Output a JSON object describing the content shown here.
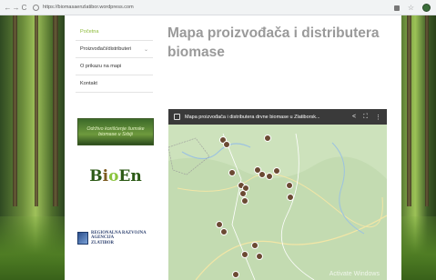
{
  "browser": {
    "back_icon": "arrow-left-icon",
    "forward_icon": "arrow-right-icon",
    "reload_icon": "reload-icon",
    "url": "https://biomasaenzlatibor.wordpress.com"
  },
  "menu": {
    "items": [
      {
        "label": "Početna",
        "active": true
      },
      {
        "label": "Proizvođači/distributeri",
        "dropdown": true
      },
      {
        "label": "O prikazu na mapi"
      },
      {
        "label": "Kontakt"
      }
    ]
  },
  "widgets": {
    "banner_text": "Održivo korišćenje šumske biomase u Srbiji",
    "bioen_logo": "BioEn",
    "agency_lines": [
      "REGIONALNA RAZVOJNA",
      "AGENCIJA",
      "ZLATIBOR"
    ]
  },
  "page": {
    "title": "Mapa proizvođača i distributera biomase"
  },
  "map": {
    "title": "Mapa proizvođača i distributera drvne biomase u Zlatiborsk...",
    "share_icon": "share-icon",
    "fullscreen_icon": "fullscreen-icon",
    "more_icon": "more-vert-icon",
    "marker_color": "#6b4a33",
    "watermark": "Activate Windows"
  }
}
